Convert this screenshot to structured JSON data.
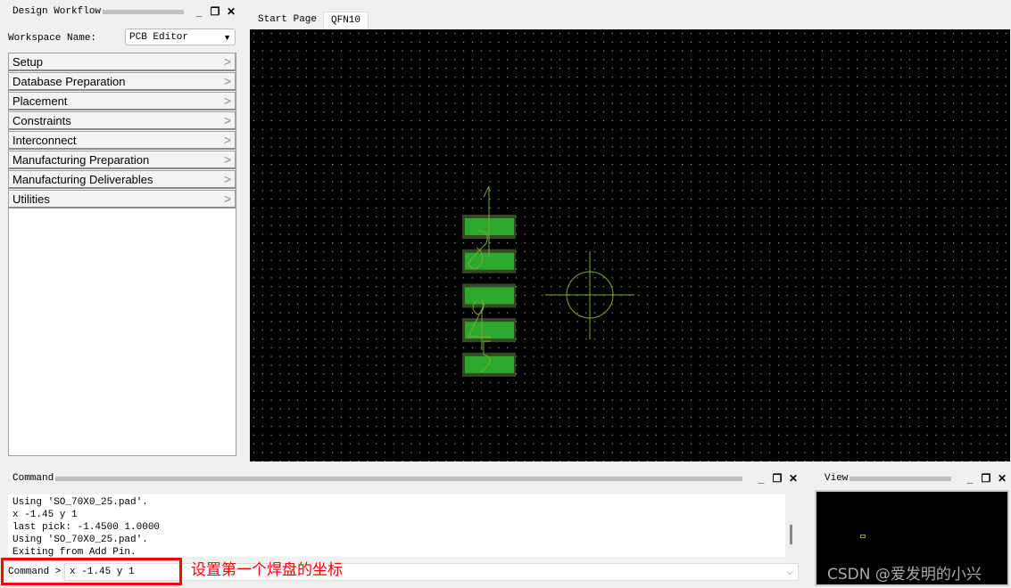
{
  "workflow": {
    "title": "Design Workflow",
    "workspace_label": "Workspace Name:",
    "workspace_value": "PCB Editor",
    "items": [
      {
        "label": "Setup"
      },
      {
        "label": "Database Preparation"
      },
      {
        "label": "Placement"
      },
      {
        "label": "Constraints"
      },
      {
        "label": "Interconnect"
      },
      {
        "label": "Manufacturing Preparation"
      },
      {
        "label": "Manufacturing Deliverables"
      },
      {
        "label": "Utilities"
      }
    ]
  },
  "tabs": [
    {
      "label": "Start Page"
    },
    {
      "label": "QFN10"
    }
  ],
  "canvas": {
    "background": "#000000",
    "pad_color": "#2ca82c",
    "pad_count": 5,
    "pin_labels": [
      "1",
      "2",
      "3",
      "4",
      "5"
    ]
  },
  "command": {
    "title": "Command",
    "log": [
      "Using 'SO_70X0_25.pad'.",
      "x -1.45 y 1",
      "last pick:  -1.4500 1.0000",
      "Using 'SO_70X0_25.pad'.",
      "Exiting from Add Pin."
    ],
    "prompt": "Command >",
    "input_value": "x -1.45 y 1"
  },
  "view": {
    "title": "View"
  },
  "annotation": {
    "text": "设置第一个焊盘的坐标",
    "color": "#ff0000"
  },
  "watermark": "CSDN @爱发明的小兴"
}
